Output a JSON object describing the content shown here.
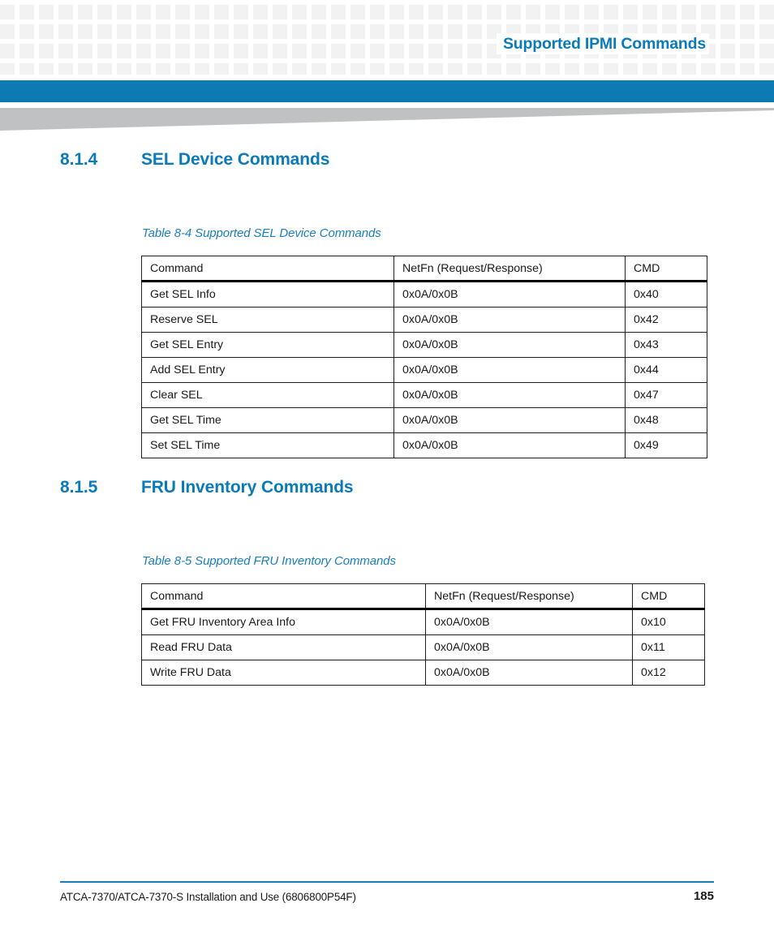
{
  "header": {
    "title": "Supported IPMI Commands",
    "accent_color": "#0b7ab8",
    "bar_color": "#0e7ab4",
    "wedge_color": "#bfc1c3",
    "checker_color": "#f2f2f3"
  },
  "sections": [
    {
      "number": "8.1.4",
      "title": "SEL Device Commands",
      "caption": "Table 8-4 Supported SEL Device Commands",
      "table": {
        "headers": [
          "Command",
          "NetFn (Request/Response)",
          "CMD"
        ],
        "rows": [
          [
            "Get SEL Info",
            "0x0A/0x0B",
            "0x40"
          ],
          [
            "Reserve SEL",
            "0x0A/0x0B",
            "0x42"
          ],
          [
            "Get SEL Entry",
            "0x0A/0x0B",
            "0x43"
          ],
          [
            "Add SEL Entry",
            "0x0A/0x0B",
            "0x44"
          ],
          [
            "Clear SEL",
            "0x0A/0x0B",
            "0x47"
          ],
          [
            "Get SEL Time",
            "0x0A/0x0B",
            "0x48"
          ],
          [
            "Set SEL Time",
            "0x0A/0x0B",
            "0x49"
          ]
        ]
      }
    },
    {
      "number": "8.1.5",
      "title": "FRU Inventory Commands",
      "caption": "Table 8-5 Supported FRU Inventory Commands",
      "table": {
        "headers": [
          "Command",
          "NetFn (Request/Response)",
          "CMD"
        ],
        "rows": [
          [
            "Get FRU Inventory Area Info",
            "0x0A/0x0B",
            "0x10"
          ],
          [
            "Read FRU Data",
            "0x0A/0x0B",
            "0x11"
          ],
          [
            "Write FRU Data",
            "0x0A/0x0B",
            "0x12"
          ]
        ]
      }
    }
  ],
  "footer": {
    "document": "ATCA-7370/ATCA-7370-S Installation and Use (6806800P54F)",
    "page_number": "185",
    "rule_color": "#1b7fbd"
  }
}
